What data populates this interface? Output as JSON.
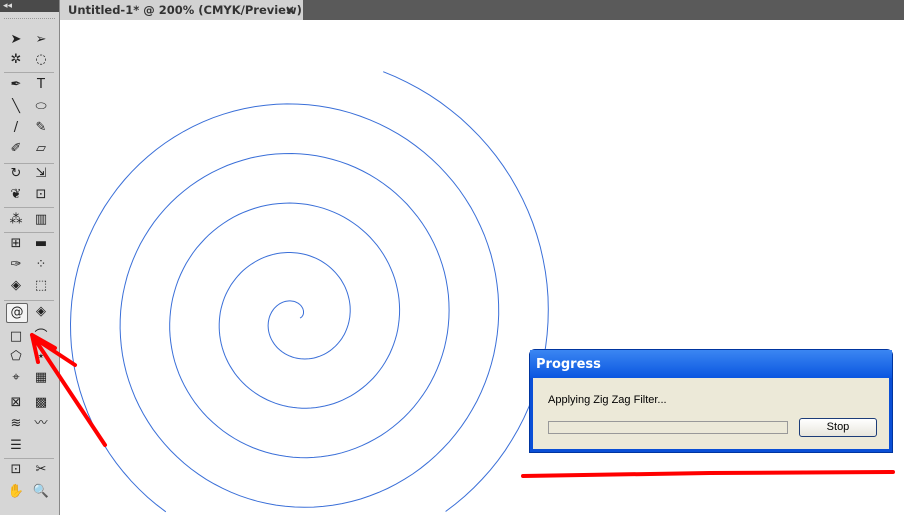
{
  "document_tab": {
    "title": "Untitled-1* @ 200% (CMYK/Preview)",
    "close": "×"
  },
  "toolbar": {
    "collapse": "◂◂",
    "tools": [
      {
        "name": "selection-tool",
        "glyph": "➤"
      },
      {
        "name": "direct-selection-tool",
        "glyph": "➢"
      },
      {
        "name": "magic-wand-tool",
        "glyph": "✲"
      },
      {
        "name": "lasso-tool",
        "glyph": "◌"
      },
      {
        "name": "pen-tool",
        "glyph": "✒"
      },
      {
        "name": "type-tool",
        "glyph": "T"
      },
      {
        "name": "line-tool",
        "glyph": "╲"
      },
      {
        "name": "ellipse-tool",
        "glyph": "⬭"
      },
      {
        "name": "paintbrush-tool",
        "glyph": "/"
      },
      {
        "name": "pencil-tool",
        "glyph": "✎"
      },
      {
        "name": "blob-brush-tool",
        "glyph": "✐"
      },
      {
        "name": "eraser-tool",
        "glyph": "▱"
      },
      {
        "name": "rotate-tool",
        "glyph": "↻"
      },
      {
        "name": "scale-tool",
        "glyph": "⇲"
      },
      {
        "name": "warp-tool",
        "glyph": "❦"
      },
      {
        "name": "free-transform-tool",
        "glyph": "⊡"
      },
      {
        "name": "symbol-sprayer-tool",
        "glyph": "⁂"
      },
      {
        "name": "column-graph-tool",
        "glyph": "▥"
      },
      {
        "name": "mesh-tool",
        "glyph": "⊞"
      },
      {
        "name": "gradient-tool",
        "glyph": "▬"
      },
      {
        "name": "eyedropper-tool",
        "glyph": "✑"
      },
      {
        "name": "blend-tool",
        "glyph": "⁘"
      },
      {
        "name": "live-paint-bucket-tool",
        "glyph": "◈"
      },
      {
        "name": "live-paint-selection-tool",
        "glyph": "⬚"
      },
      {
        "name": "spiral-tool",
        "glyph": "@"
      },
      {
        "name": "flare-tool",
        "glyph": "◈"
      },
      {
        "name": "rectangle-tool",
        "glyph": "□"
      },
      {
        "name": "arc-tool",
        "glyph": "⌒"
      },
      {
        "name": "polygon-tool",
        "glyph": "⬠"
      },
      {
        "name": "star-tool",
        "glyph": "⋆"
      },
      {
        "name": "perspective-tool",
        "glyph": "⌖"
      },
      {
        "name": "grid-tool",
        "glyph": "▦"
      },
      {
        "name": "envelope-tool",
        "glyph": "⊠"
      },
      {
        "name": "rectangular-grid-tool",
        "glyph": "▩"
      },
      {
        "name": "twirl-tool",
        "glyph": "≋"
      },
      {
        "name": "zigzag-tool",
        "glyph": "〰"
      },
      {
        "name": "list-tool",
        "glyph": "☰"
      },
      {
        "name": "blank-tool",
        "glyph": ""
      },
      {
        "name": "artboard-tool",
        "glyph": "⊡"
      },
      {
        "name": "slice-tool",
        "glyph": "✂"
      },
      {
        "name": "hand-tool",
        "glyph": "✋"
      },
      {
        "name": "zoom-tool",
        "glyph": "🔍"
      }
    ]
  },
  "dialog": {
    "title": "Progress",
    "message": "Applying Zig Zag Filter...",
    "progress_percent": 0,
    "stop_label": "Stop"
  },
  "colors": {
    "spiral": "#3a6fd8",
    "annotation": "#ff0000"
  }
}
